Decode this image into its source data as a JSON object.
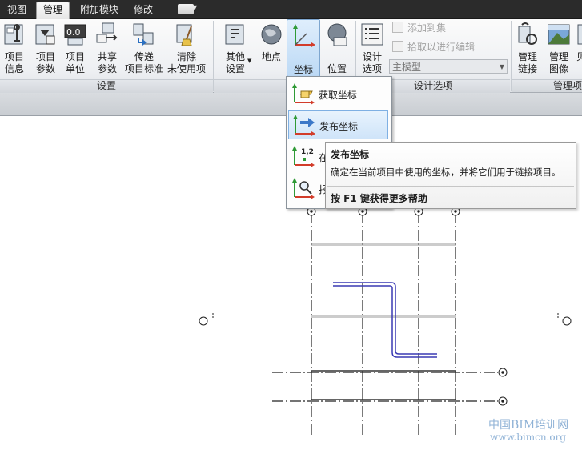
{
  "tabs": [
    {
      "label": "视图",
      "active": false
    },
    {
      "label": "管理",
      "active": true
    },
    {
      "label": "附加模块",
      "active": false
    },
    {
      "label": "修改",
      "active": false
    }
  ],
  "ribbon": {
    "settings_buttons": [
      {
        "label": "项目\n信息",
        "icon": "project-info-icon"
      },
      {
        "label": "项目\n参数",
        "icon": "project-parameters-icon"
      },
      {
        "label": "项目\n单位",
        "icon": "project-units-icon"
      },
      {
        "label": "共享\n参数",
        "icon": "shared-parameters-icon"
      },
      {
        "label": "传递\n项目标准",
        "icon": "transfer-standards-icon"
      },
      {
        "label": "清除\n未使用项",
        "icon": "purge-unused-icon"
      },
      {
        "label": "其他\n设置",
        "icon": "additional-settings-icon"
      }
    ],
    "location_buttons": [
      {
        "label": "地点",
        "icon": "location-icon"
      },
      {
        "label": "坐标",
        "icon": "coordinates-icon"
      },
      {
        "label": "位置",
        "icon": "position-icon"
      }
    ],
    "design_options_button": "设计\n选项",
    "add_to_set": "添加到集",
    "pick_to_edit": "拾取以进行编辑",
    "main_model": "主模型",
    "manage_link": "管理\n链接",
    "manage_images": "管理\n图像",
    "partial_label": "贝\n ",
    "panel_labels": {
      "settings": "设置",
      "design_options": "设计选项",
      "manage_project": "管理项"
    }
  },
  "menu": {
    "items": [
      {
        "label": "获取坐标",
        "icon": "acquire-coordinates-icon"
      },
      {
        "label": "发布坐标",
        "icon": "publish-coordinates-icon",
        "highlighted": true
      },
      {
        "label": "在",
        "icon": "specify-coordinates-icon"
      },
      {
        "label": "报",
        "icon": "report-coordinates-icon"
      }
    ]
  },
  "tooltip": {
    "title": "发布坐标",
    "description": "确定在当前项目中使用的坐标，并将它们用于链接项目。",
    "help": "按 F1 键获得更多帮助"
  },
  "watermark": {
    "line1": "中国BIM培训网",
    "line2": "www.bimcn.org"
  },
  "colors": {
    "accent_blue": "#3c78c8",
    "axis_red": "#d23c2a",
    "axis_green": "#2f9a36",
    "wall_blue": "#3a3ab4"
  }
}
